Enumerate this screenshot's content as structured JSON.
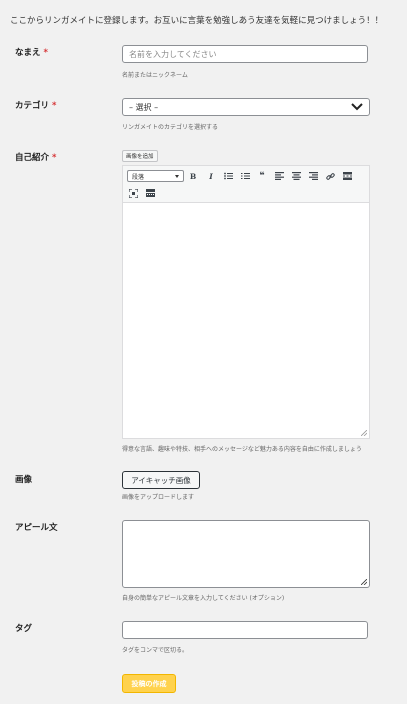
{
  "intro": "ここからリンガメイトに登録します。お互いに言葉を勉強しあう友達を気軽に見つけましょう！！",
  "required_mark": "*",
  "name": {
    "label": "なまえ",
    "placeholder": "名前を入力してください",
    "help": "名前またはニックネーム"
  },
  "category": {
    "label": "カテゴリ",
    "selected": "– 選択 –",
    "help": "リンガメイトのカテゴリを選択する"
  },
  "intro_text": {
    "label": "自己紹介",
    "add_media": "画像を追加",
    "format_select": "段落",
    "help": "得意な言語、趣味や特技、相手へのメッセージなど魅力ある内容を自由に作成しましょう",
    "toolbar_icons": [
      "bold-icon",
      "italic-icon",
      "bullet-list-icon",
      "numbered-list-icon",
      "blockquote-icon",
      "align-left-icon",
      "align-center-icon",
      "align-right-icon",
      "link-icon",
      "read-more-icon",
      "fullscreen-icon",
      "toolbar-toggle-icon"
    ]
  },
  "image": {
    "label": "画像",
    "button": "アイキャッチ画像",
    "help": "画像をアップロードします"
  },
  "appeal": {
    "label": "アピール文",
    "help": "自身の簡単なアピール文章を入力してください (オプション)"
  },
  "tag": {
    "label": "タグ",
    "help": "タグをコンマで区切る。"
  },
  "submit": "投稿の作成",
  "colors": {
    "submit_bg": "#ffd24d",
    "required": "#d63638",
    "page_bg": "#f1f1f1"
  }
}
